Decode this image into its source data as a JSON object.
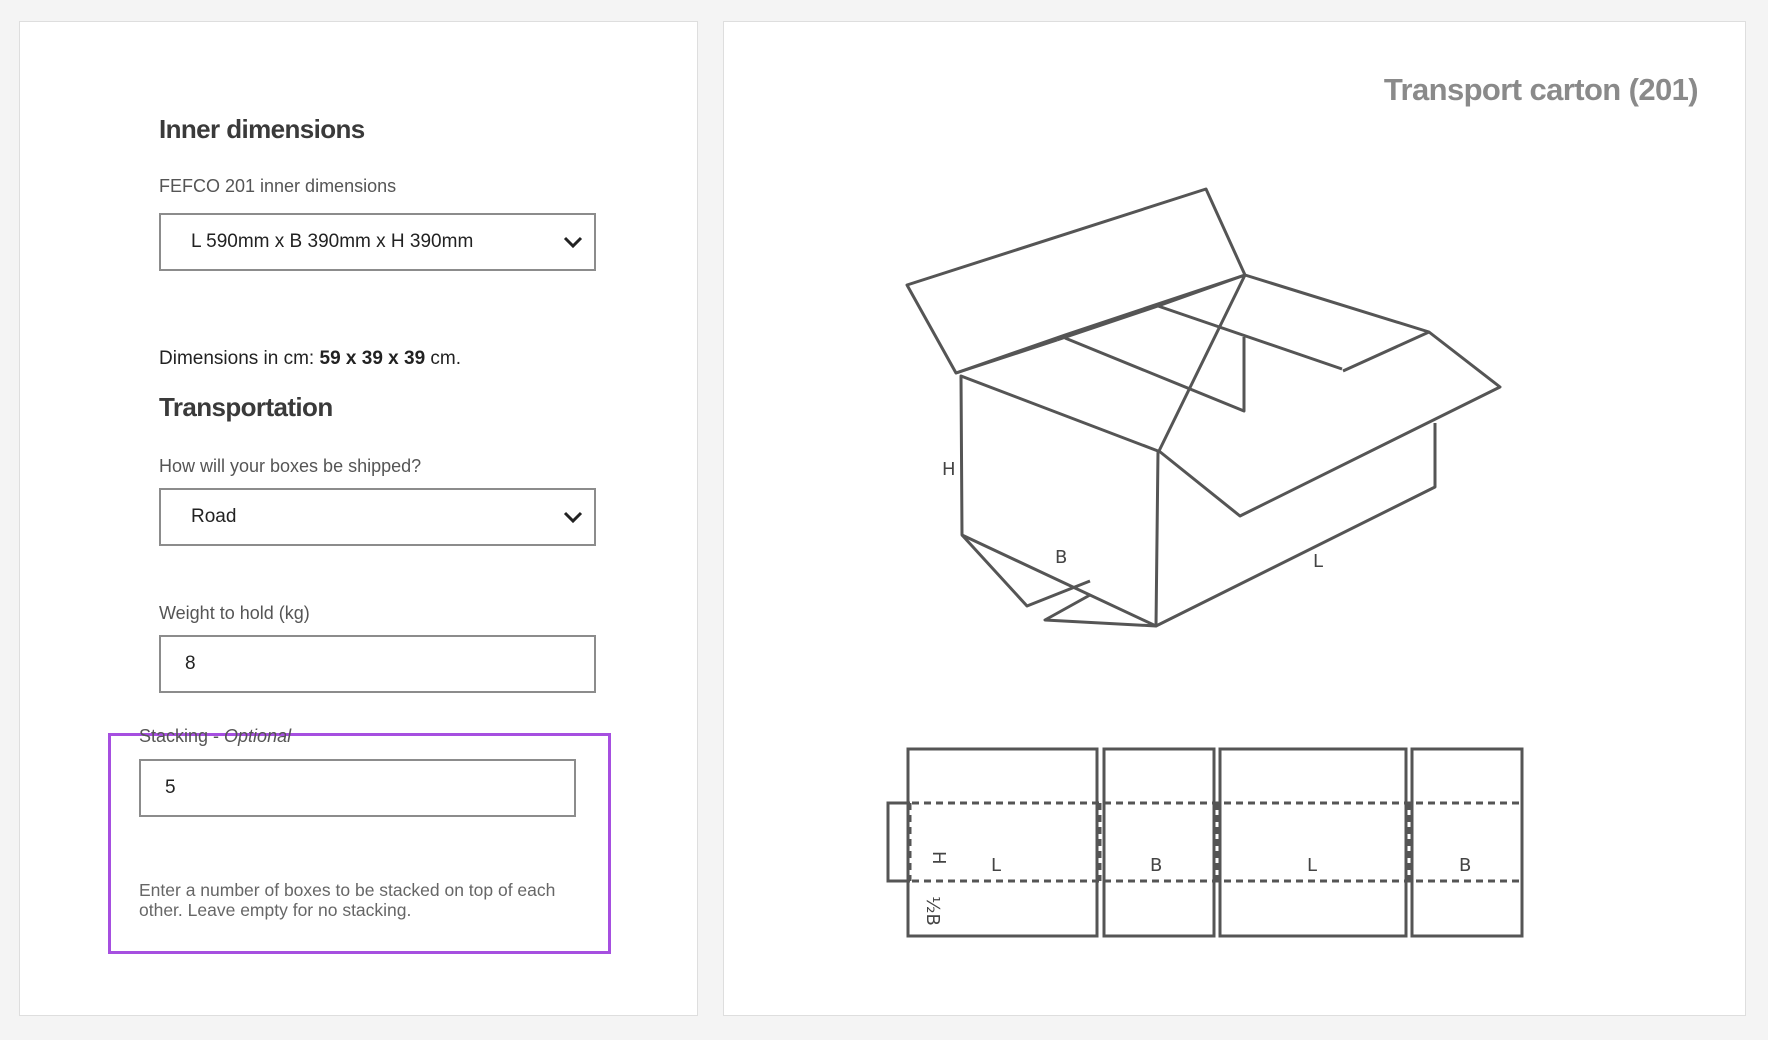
{
  "inner_dimensions": {
    "heading": "Inner dimensions",
    "field_label": "FEFCO 201 inner dimensions",
    "selected": "L 590mm x B 390mm x H 390mm",
    "dims_prefix": "Dimensions in cm: ",
    "dims_value": "59 x 39 x 39",
    "dims_suffix": " cm."
  },
  "transportation": {
    "heading": "Transportation",
    "field_label": "How will your boxes be shipped?",
    "selected": "Road"
  },
  "weight": {
    "label": "Weight to hold (kg)",
    "value": "8"
  },
  "stacking": {
    "label": "Stacking",
    "label_suffix": "Optional",
    "value": "5",
    "help": "Enter a number of boxes to be stacked on top of each other. Leave empty for no stacking.",
    "highlight_color": "#a64fe0"
  },
  "diagram": {
    "title": "Transport carton (201)",
    "box_labels": {
      "h": "H",
      "b": "B",
      "l": "L"
    },
    "flat_labels": {
      "h": "H",
      "half_b": "½B",
      "panels": [
        "L",
        "B",
        "L",
        "B"
      ]
    }
  },
  "icons": {
    "dropdown": "chevron-down-icon"
  }
}
